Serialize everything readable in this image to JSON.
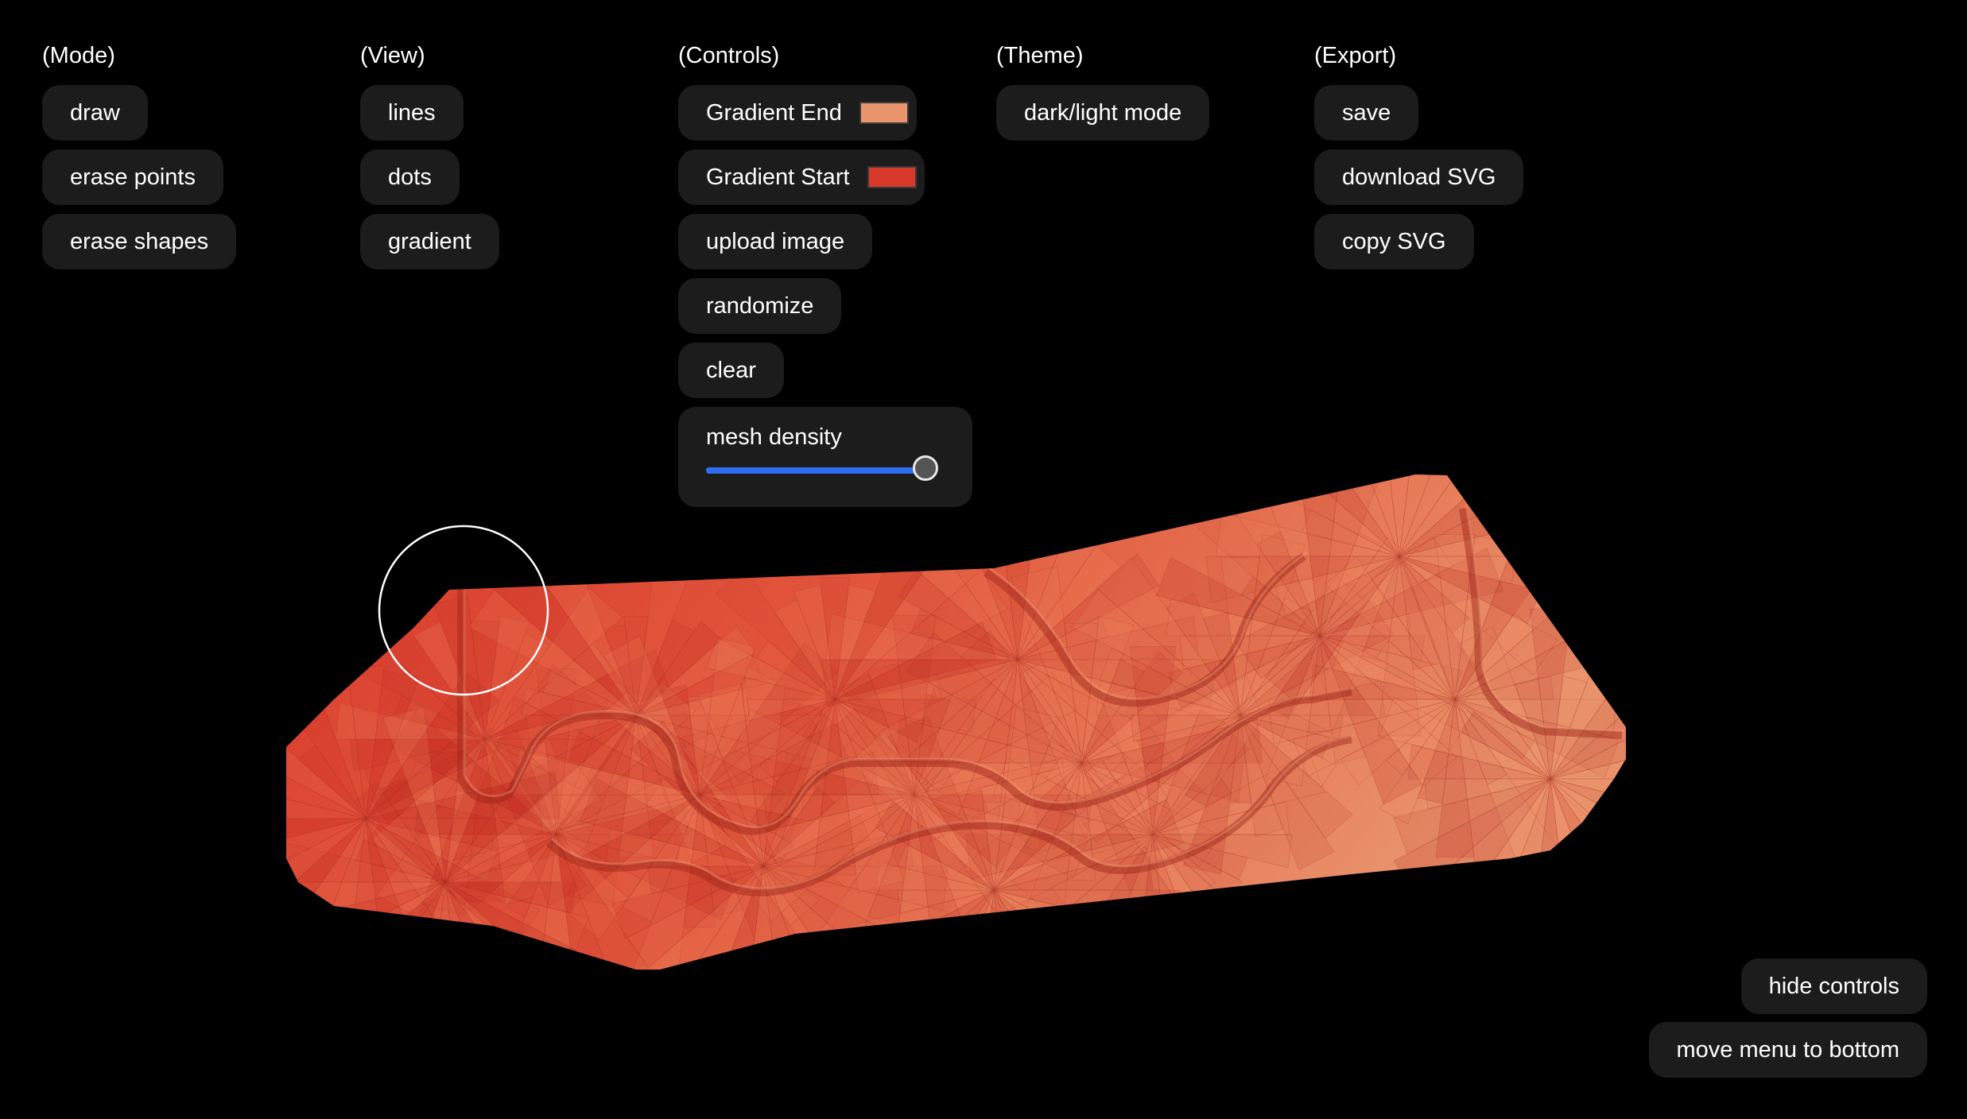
{
  "colors": {
    "gradient_end": "#e9946d",
    "gradient_start": "#d9392b",
    "background": "#000000",
    "button_bg": "#1c1c1c",
    "slider_accent": "#2d6ff0"
  },
  "mode": {
    "title": "(Mode)",
    "buttons": [
      "draw",
      "erase points",
      "erase shapes"
    ]
  },
  "view": {
    "title": "(View)",
    "buttons": [
      "lines",
      "dots",
      "gradient"
    ]
  },
  "controls": {
    "title": "(Controls)",
    "gradient_end_label": "Gradient End",
    "gradient_start_label": "Gradient Start",
    "upload_label": "upload image",
    "randomize_label": "randomize",
    "clear_label": "clear",
    "mesh_density_label": "mesh density",
    "mesh_density_value": 1.0
  },
  "theme": {
    "title": "(Theme)",
    "toggle_label": "dark/light mode"
  },
  "export": {
    "title": "(Export)",
    "buttons": [
      "save",
      "download SVG",
      "copy SVG"
    ]
  },
  "footer": {
    "hide_controls": "hide controls",
    "move_menu": "move menu to bottom"
  },
  "canvas": {
    "cursor_icon": "brush-cursor-circle-icon"
  }
}
